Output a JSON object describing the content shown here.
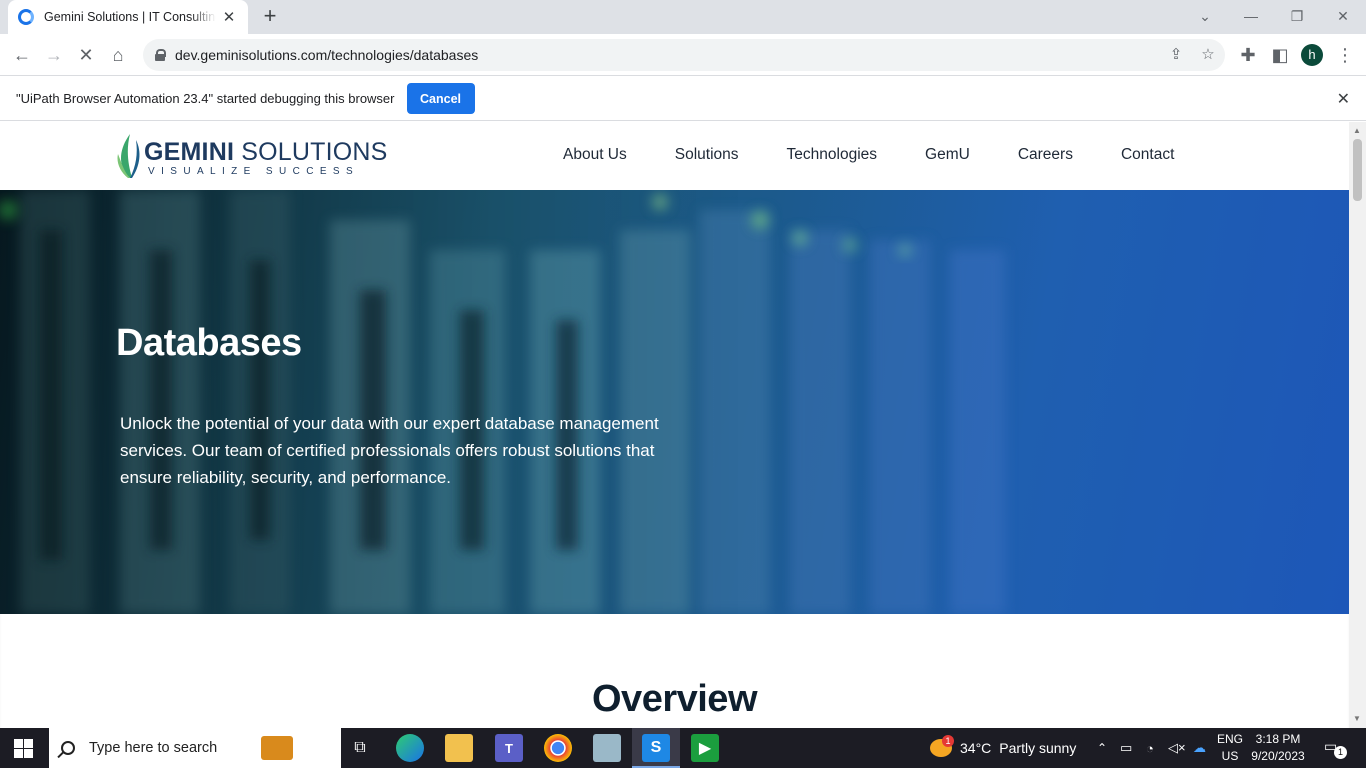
{
  "browser": {
    "tab_title": "Gemini Solutions | IT Consulting",
    "url": "dev.geminisolutions.com/technologies/databases",
    "profile_initial": "h",
    "infobar_message": "\"UiPath Browser Automation 23.4\" started debugging this browser",
    "infobar_cancel": "Cancel"
  },
  "site": {
    "logo_word_bold": "GEMINI",
    "logo_word_light": " SOLUTIONS",
    "logo_tagline": "VISUALIZE SUCCESS",
    "menu": [
      "About Us",
      "Solutions",
      "Technologies",
      "GemU",
      "Careers",
      "Contact"
    ],
    "hero_title": "Databases",
    "hero_text": "Unlock the potential of your data with our expert database management services. Our team of certified professionals offers robust solutions that ensure reliability, security, and performance.",
    "overview_title": "Overview"
  },
  "taskbar": {
    "search_placeholder": "Type here to search",
    "weather_temp": "34°C",
    "weather_text": "Partly sunny",
    "weather_badge": "1",
    "lang_line1": "ENG",
    "lang_line2": "US",
    "time": "3:18 PM",
    "date": "9/20/2023",
    "notif_count": "1"
  },
  "colors": {
    "accent": "#1a73e8",
    "brand_navy": "#1e3a5f",
    "brand_green": "#3aa66b"
  }
}
